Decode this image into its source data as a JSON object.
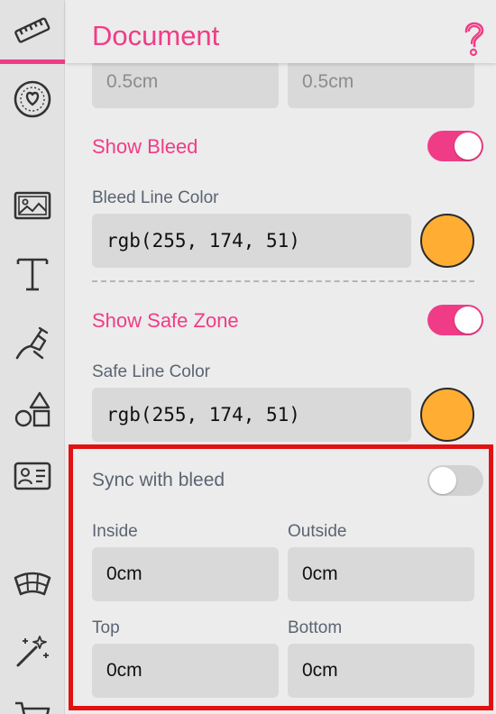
{
  "panel": {
    "title": "Document",
    "top_margins": {
      "left_value": "0.5cm",
      "right_value": "0.5cm"
    },
    "show_bleed": {
      "label": "Show Bleed",
      "on": true
    },
    "bleed_color": {
      "label": "Bleed Line Color",
      "value": "rgb(255, 174, 51)",
      "swatch": "#ffae33"
    },
    "show_safe_zone": {
      "label": "Show Safe Zone",
      "on": true
    },
    "safe_color": {
      "label": "Safe Line Color",
      "value": "rgb(255, 174, 51)",
      "swatch": "#ffae33"
    },
    "sync_with_bleed": {
      "label": "Sync with bleed",
      "on": false
    },
    "inside": {
      "label": "Inside",
      "value": "0cm"
    },
    "outside": {
      "label": "Outside",
      "value": "0cm"
    },
    "top": {
      "label": "Top",
      "value": "0cm"
    },
    "bottom": {
      "label": "Bottom",
      "value": "0cm"
    }
  },
  "sidebar": {
    "items": [
      "ruler-icon",
      "heart-badge-icon",
      "image-icon",
      "text-icon",
      "pen-tool-icon",
      "shapes-icon",
      "id-card-icon",
      "arc-grid-icon",
      "magic-wand-icon",
      "cart-icon"
    ],
    "active": "ruler-icon"
  },
  "colors": {
    "accent": "#f03c87",
    "highlight_border": "#e21212"
  }
}
